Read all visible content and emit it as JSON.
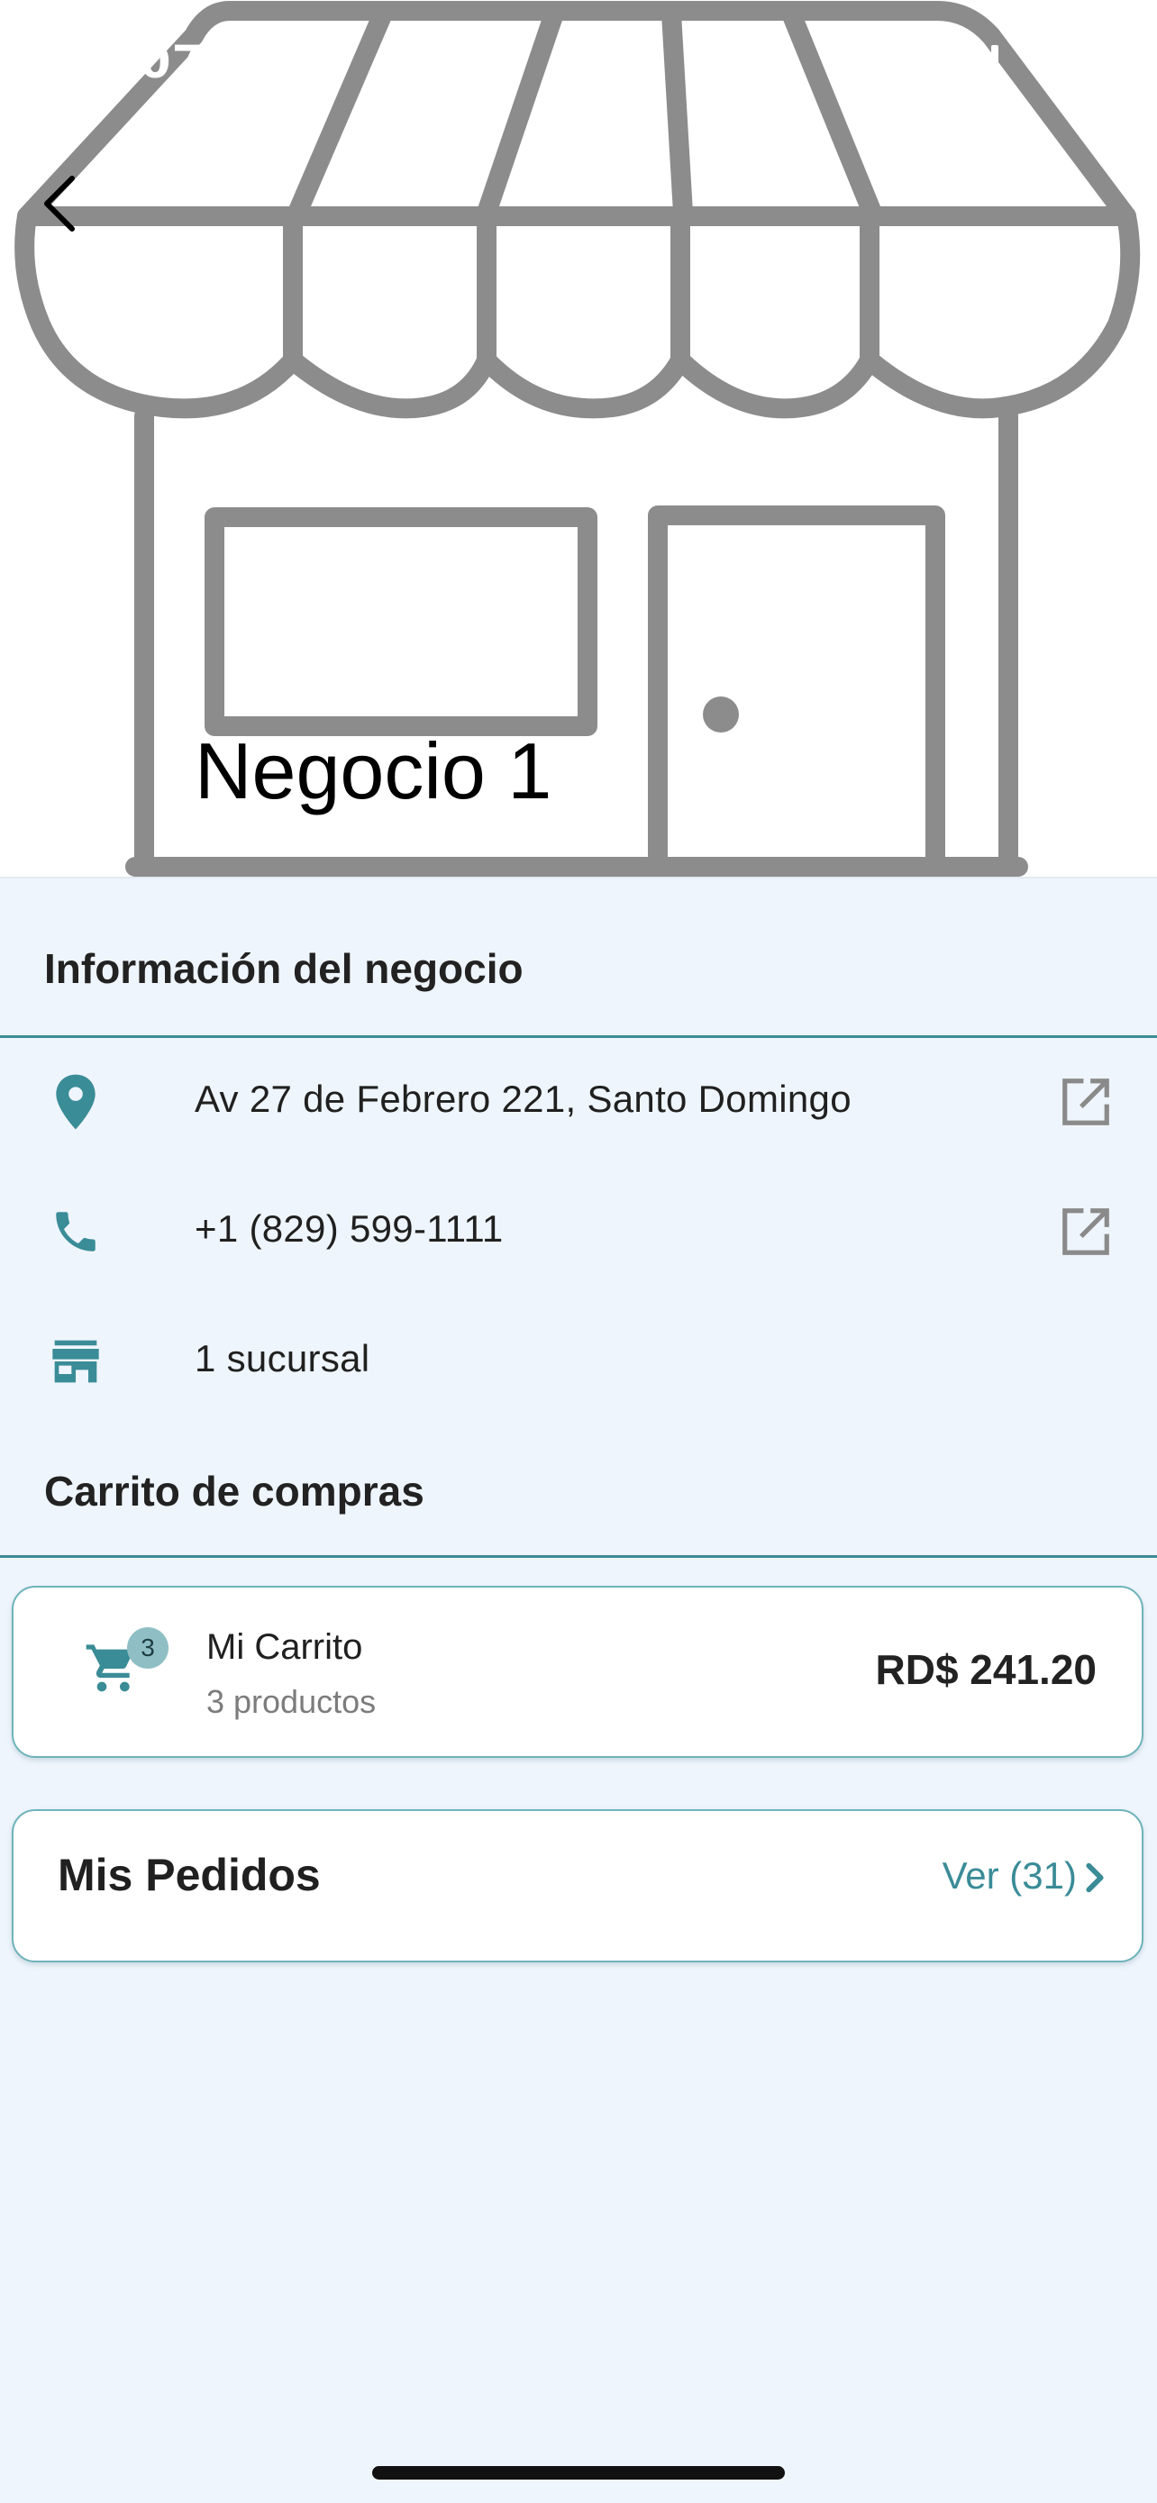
{
  "status_bar": {
    "time": "9:07"
  },
  "hero": {
    "store_name": "Negocio 1"
  },
  "info_section": {
    "title": "Información del negocio",
    "address": "Av 27 de Febrero 221, Santo Domingo",
    "phone": "+1 (829) 599-1111",
    "branches": "1 sucursal"
  },
  "cart_section": {
    "title": "Carrito de compras",
    "card": {
      "badge_count": "3",
      "title": "Mi Carrito",
      "subtitle": "3 productos",
      "total": "RD$ 241.20"
    }
  },
  "orders": {
    "title": "Mis Pedidos",
    "link_label": "Ver (31)"
  },
  "colors": {
    "accent": "#3a8c97",
    "background": "#eff5fd",
    "hero_art": "#8c8c8c"
  },
  "icons": {
    "address": "location-pin-icon",
    "phone": "phone-icon",
    "branches": "storefront-icon",
    "external": "open-external-icon",
    "cart": "shopping-cart-icon",
    "chevron": "chevron-right-icon",
    "back": "back-arrow-icon"
  }
}
